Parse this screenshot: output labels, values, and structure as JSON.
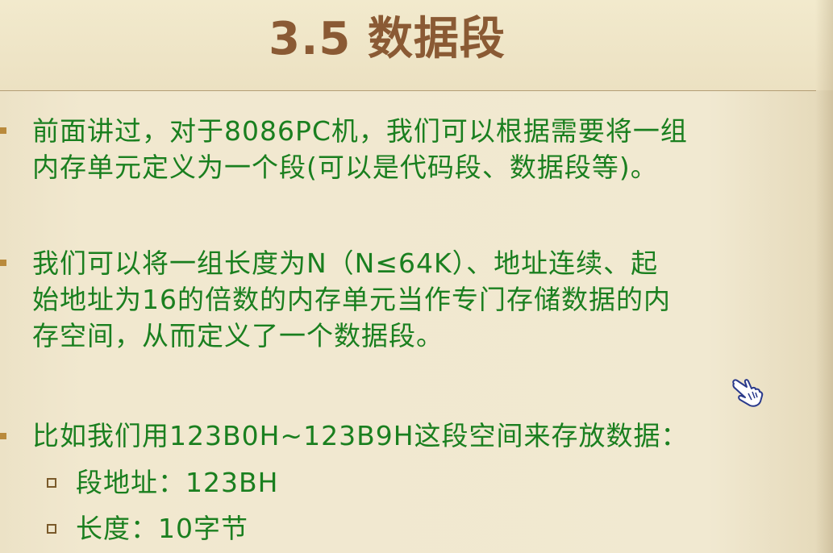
{
  "slide": {
    "title": "3.5 数据段",
    "bullets": [
      {
        "lines": [
          "前面讲过，对于8086PC机，我们可以根据需要将一组",
          "内存单元定义为一个段(可以是代码段、数据段等)。"
        ]
      },
      {
        "lines": [
          "我们可以将一组长度为N（N≤64K）、地址连续、起",
          "始地址为16的倍数的内存单元当作专门存储数据的内",
          "存空间，从而定义了一个数据段。"
        ]
      },
      {
        "lines": [
          "比如我们用123B0H~123B9H这段空间来存放数据："
        ]
      }
    ],
    "sub_items": [
      "段地址：123BH",
      "长度：10字节"
    ]
  },
  "colors": {
    "title": "#8a5a34",
    "body_text": "#1a7f1f",
    "bullet": "#b98a3c",
    "background": "#f1e9d1"
  },
  "icons": {
    "cursor": "hand-pointer-icon"
  }
}
